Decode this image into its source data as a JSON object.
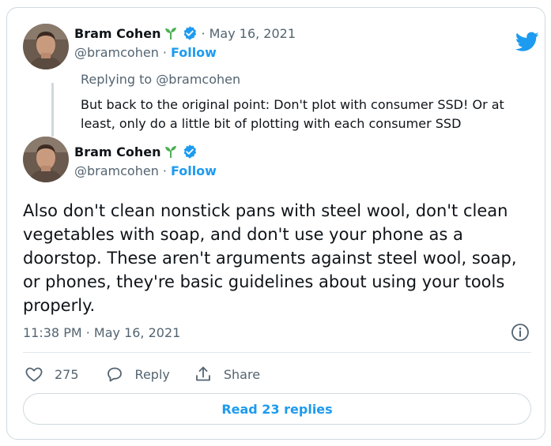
{
  "colors": {
    "accent": "#1d9bf0",
    "text_primary": "#0f1419",
    "text_secondary": "#536471",
    "border": "#cfd9de",
    "sprout": "#4cb054"
  },
  "reply_tweet": {
    "name": "Bram Cohen",
    "name_icon": "sprout-icon",
    "verified_icon": "verified-badge-icon",
    "separator": "·",
    "date": "May 16, 2021",
    "handle": "@bramcohen",
    "follow_label": "Follow",
    "replying_to": "Replying to @bramcohen",
    "text": "But back to the original point: Don't plot with consumer SSD! Or at least, only do a little bit of plotting with each consumer SSD"
  },
  "main_tweet": {
    "name": "Bram Cohen",
    "name_icon": "sprout-icon",
    "verified_icon": "verified-badge-icon",
    "separator": "·",
    "handle": "@bramcohen",
    "follow_label": "Follow",
    "text": "Also don't clean nonstick pans with steel wool, don't clean vegetables with soap, and don't use your phone as a doorstop. These aren't arguments against steel wool, soap, or phones, they're basic guidelines about using your tools properly.",
    "timestamp": "11:38 PM · May 16, 2021"
  },
  "actions": {
    "like_count": "275",
    "reply_label": "Reply",
    "share_label": "Share"
  },
  "read_replies_label": "Read 23 replies",
  "icons": {
    "brand": "twitter-bird-icon",
    "info": "info-icon",
    "like": "heart-icon",
    "reply": "reply-bubble-icon",
    "share": "share-icon"
  }
}
